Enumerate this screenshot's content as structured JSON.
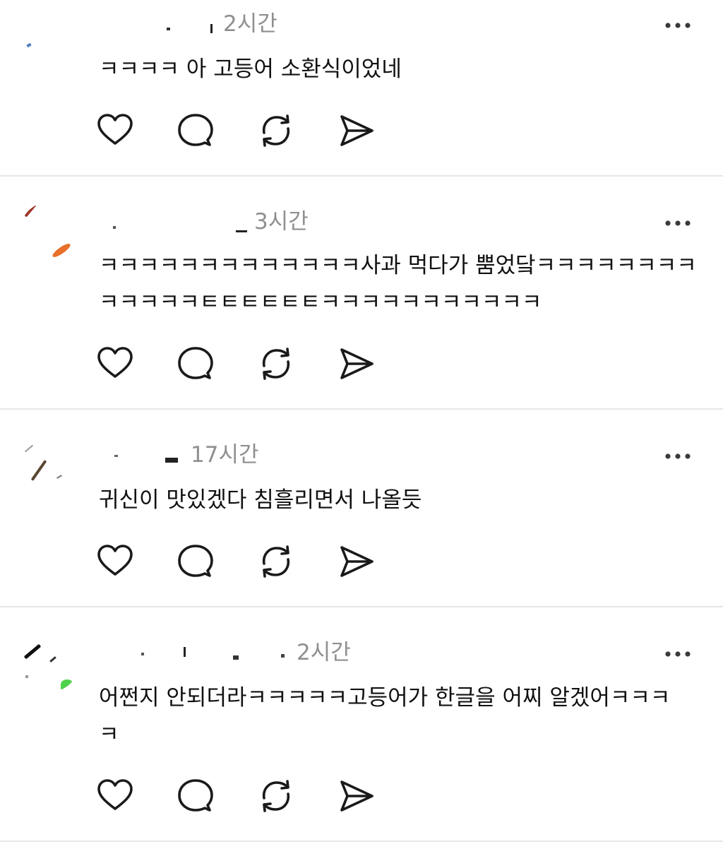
{
  "posts": [
    {
      "time": "2시간",
      "text": "ㅋㅋㅋㅋ 아 고등어 소환식이었네"
    },
    {
      "time": "3시간",
      "text": "ㅋㅋㅋㅋㅋㅋㅋㅋㅋㅋㅋㅋㅋ사과 먹다가 뿜었닼ㅋㅋㅋㅋㅋㅋㅋㅋㅋㅋㅋㅋㅋㅌㅌㅌㅌㅌㅌㅋㅋㅋㅋㅋㅋㅋㅋㅋㅋㅋ"
    },
    {
      "time": "17시간",
      "text": "귀신이 맛있겠다 침흘리면서 나올듯"
    },
    {
      "time": "2시간",
      "text": "어쩐지 안되더라ㅋㅋㅋㅋㅋ고등어가 한글을 어찌 알겠어ㅋㅋㅋㅋ"
    }
  ],
  "icons": {
    "like": "heart-icon",
    "reply": "comment-icon",
    "repost": "repost-icon",
    "share": "send-icon",
    "more": "more-icon"
  },
  "colors": {
    "time": "#8f8f8f",
    "divider": "#e6e6e6",
    "icon": "#1a1a1a"
  }
}
